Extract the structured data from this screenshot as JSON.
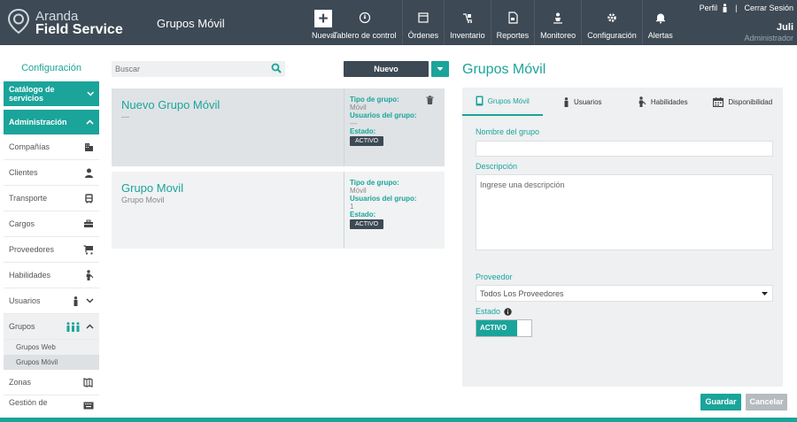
{
  "header": {
    "brand_line1": "Aranda",
    "brand_line2": "Field Service",
    "app_title": "Grupos Móvil",
    "nav": [
      {
        "label": "Nueva",
        "icon": "plus-icon"
      },
      {
        "label": "Tablero de control",
        "icon": "dashboard-icon"
      },
      {
        "label": "Órdenes",
        "icon": "orders-icon"
      },
      {
        "label": "Inventario",
        "icon": "inventory-icon"
      },
      {
        "label": "Reportes",
        "icon": "reports-icon"
      },
      {
        "label": "Monitoreo",
        "icon": "monitor-icon"
      },
      {
        "label": "Configuración",
        "icon": "gear-icon"
      },
      {
        "label": "Alertas",
        "icon": "bell-icon"
      }
    ],
    "profile_label": "Perfil",
    "logout_label": "Cerrar Sesión",
    "user_name": "Juli",
    "user_role": "Administrador"
  },
  "sidebar": {
    "title": "Configuración",
    "catalog_label": "Catálogo de servicios",
    "admin_label": "Administración",
    "items": [
      {
        "label": "Compañías",
        "icon": "building-icon"
      },
      {
        "label": "Clientes",
        "icon": "person-icon"
      },
      {
        "label": "Transporte",
        "icon": "bus-icon"
      },
      {
        "label": "Cargos",
        "icon": "briefcase-icon"
      },
      {
        "label": "Proveedores",
        "icon": "cart-icon"
      },
      {
        "label": "Habilidades",
        "icon": "skill-icon"
      },
      {
        "label": "Usuarios",
        "icon": "user-icon"
      },
      {
        "label": "Grupos",
        "icon": "group-icon"
      }
    ],
    "sub_items": [
      {
        "label": "Grupos Web"
      },
      {
        "label": "Grupos Móvil"
      }
    ],
    "after_items": [
      {
        "label": "Zonas",
        "icon": "map-icon"
      },
      {
        "label": "Gestión de",
        "icon": "keyboard-icon"
      }
    ]
  },
  "list": {
    "search_placeholder": "Buscar",
    "new_button": "Nuevo",
    "cards": [
      {
        "title": "Nuevo Grupo Móvil",
        "subtitle": "---",
        "type_label": "Tipo de grupo:",
        "type_value": "Móvil",
        "users_label": "Usuarios del grupo:",
        "users_value": "---",
        "state_label": "Estado:",
        "state_value": "ACTIVO"
      },
      {
        "title": "Grupo Movil",
        "subtitle": "Grupo Movil",
        "type_label": "Tipo de grupo:",
        "type_value": "Móvil",
        "users_label": "Usuarios del grupo:",
        "users_value": "1",
        "state_label": "Estado:",
        "state_value": "ACTIVO"
      }
    ]
  },
  "detail": {
    "title": "Grupos Móvil",
    "tabs": [
      {
        "label": "Grupos Móvil",
        "icon": "mobile-icon"
      },
      {
        "label": "Usuarios",
        "icon": "user-icon"
      },
      {
        "label": "Habilidades",
        "icon": "skill-icon"
      },
      {
        "label": "Disponibilidad",
        "icon": "calendar-icon"
      }
    ],
    "name_label": "Nombre del grupo",
    "name_value": "",
    "desc_label": "Descripción",
    "desc_placeholder": "Ingrese una descripción",
    "provider_label": "Proveedor",
    "provider_value": "Todos Los Proveedores",
    "state_label": "Estado",
    "state_value": "ACTIVO",
    "save_button": "Guardar",
    "cancel_button": "Cancelar"
  },
  "colors": {
    "accent": "#1ba49a",
    "header": "#3d4954"
  }
}
